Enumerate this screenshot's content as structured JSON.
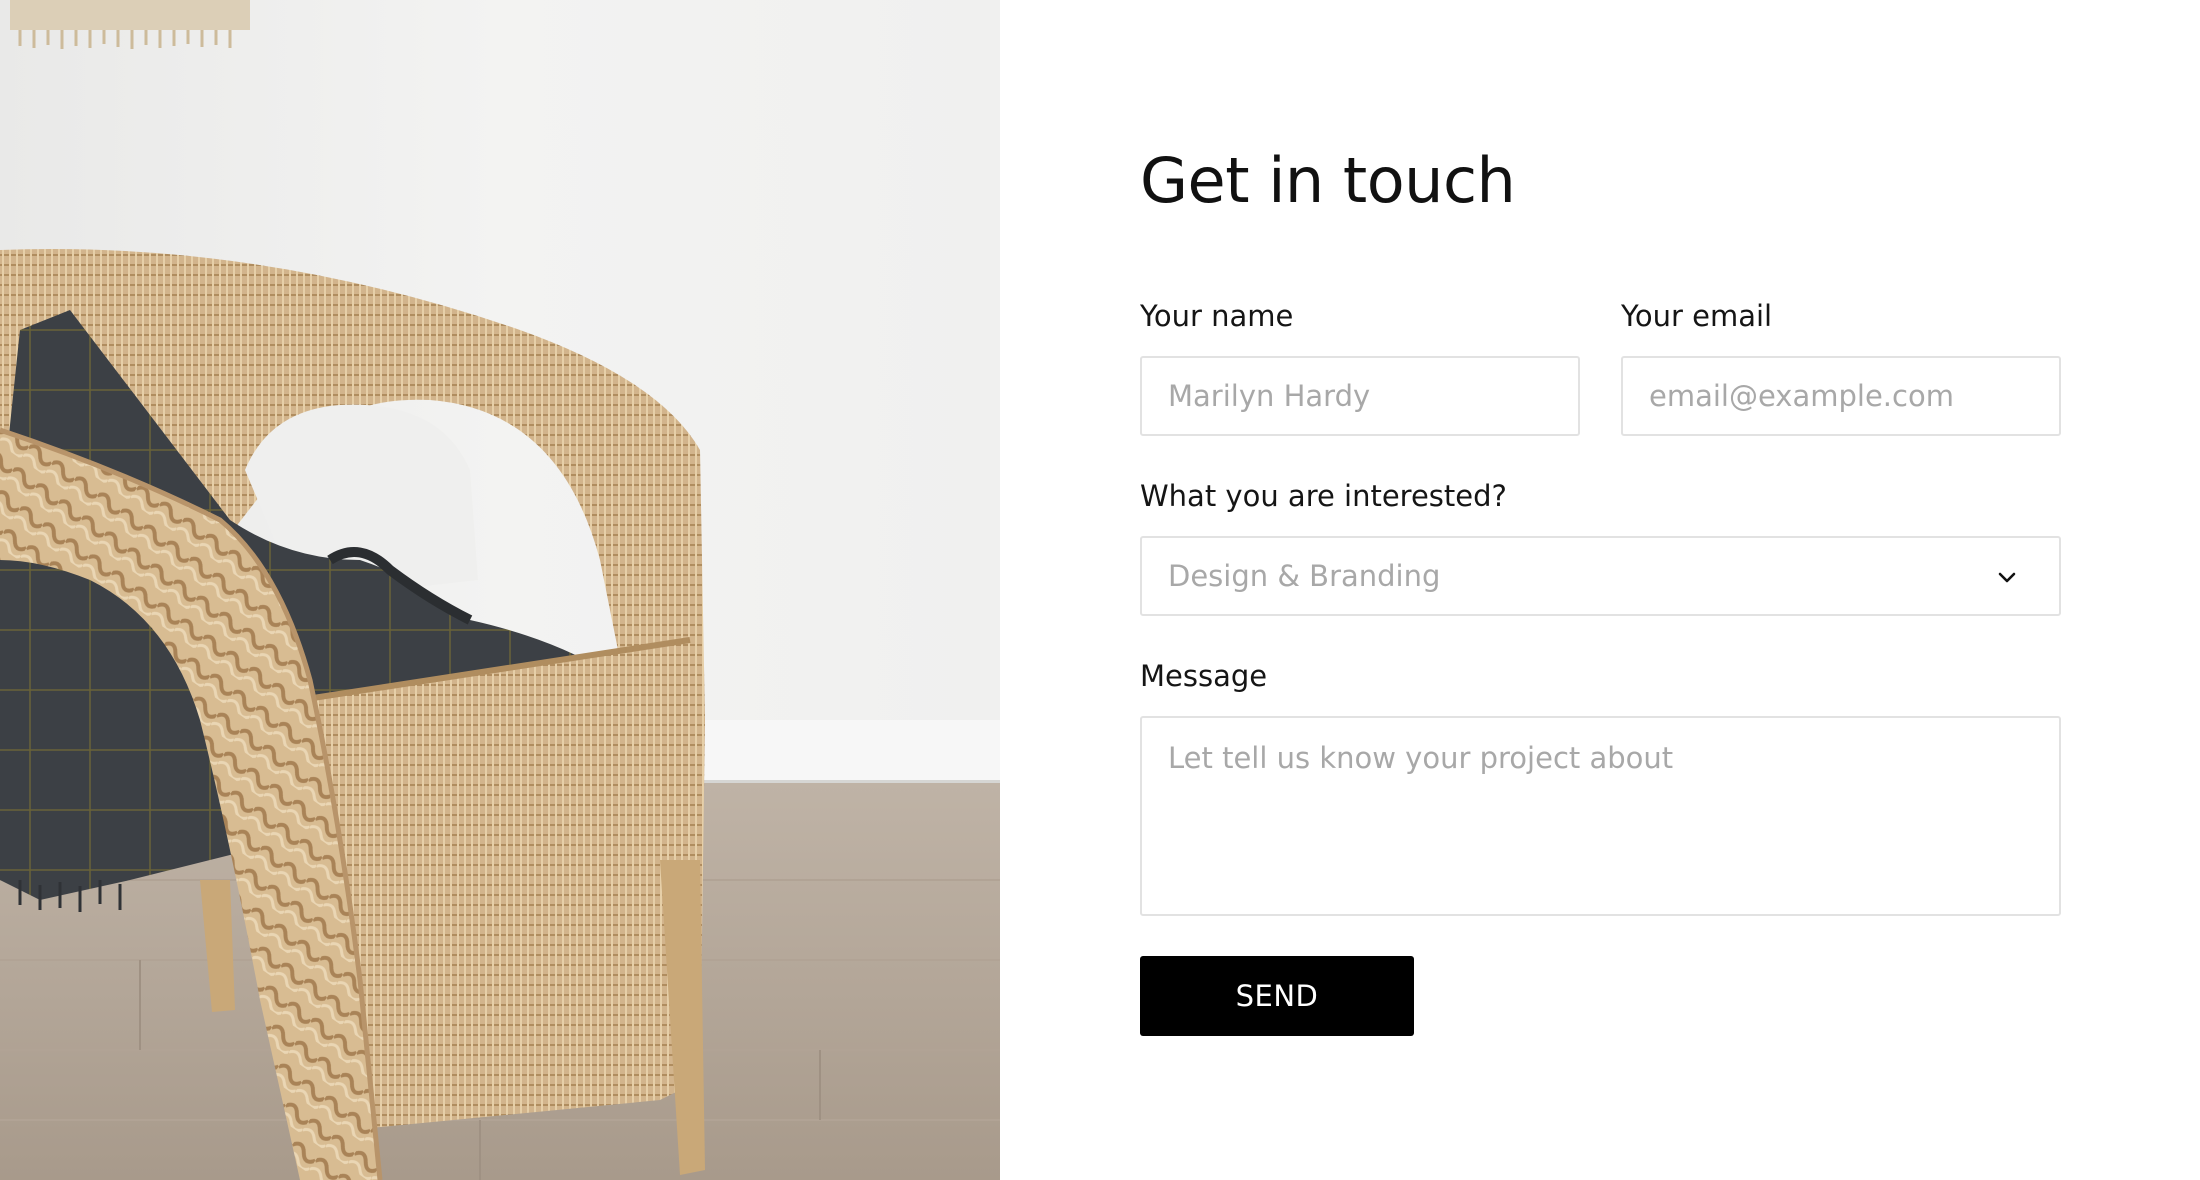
{
  "form": {
    "title": "Get in touch",
    "name_label": "Your name",
    "name_placeholder": "Marilyn Hardy",
    "email_label": "Your email",
    "email_placeholder": "email@example.com",
    "interest_label": "What you are interested?",
    "interest_selected": "Design & Branding",
    "message_label": "Message",
    "message_placeholder": "Let tell us know your project about",
    "submit_label": "SEND"
  },
  "colors": {
    "button_background": "#000000",
    "button_text": "#ffffff",
    "field_border": "#e2e2e2",
    "placeholder": "#a8a8a8"
  },
  "icons": {
    "dropdown": "chevron-down-icon"
  }
}
